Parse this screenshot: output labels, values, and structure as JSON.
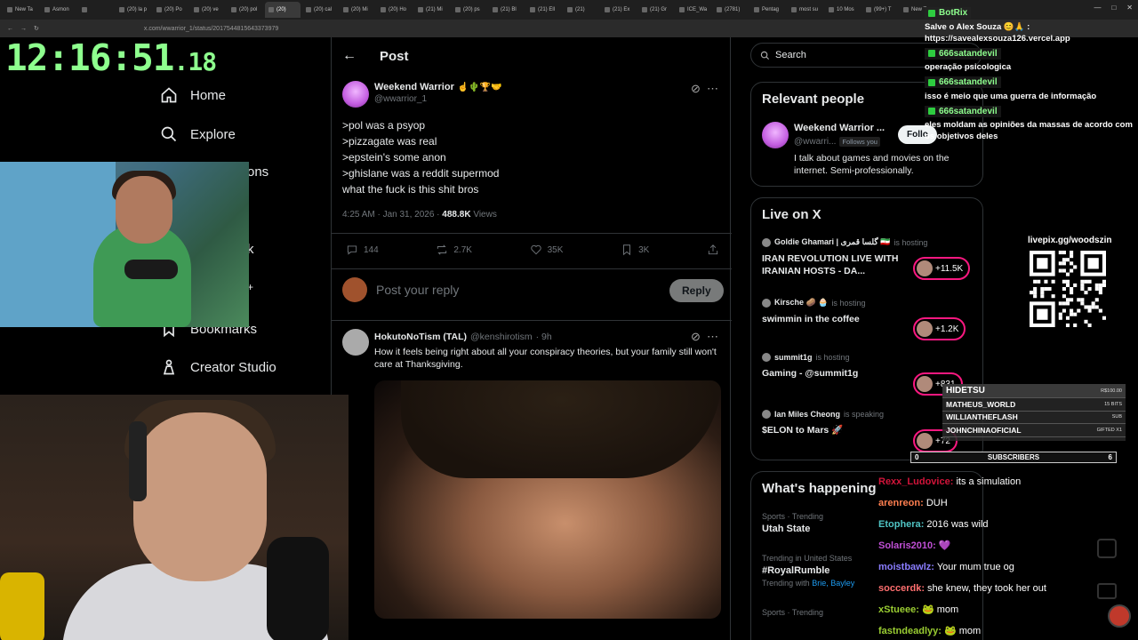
{
  "browser": {
    "tabs": [
      {
        "label": "New Ta",
        "active": false
      },
      {
        "label": "Asmon",
        "active": false
      },
      {
        "label": "",
        "active": false
      },
      {
        "label": "(20) la p",
        "active": false
      },
      {
        "label": "(20) Po",
        "active": false
      },
      {
        "label": "(20) ve",
        "active": false
      },
      {
        "label": "(20) pol",
        "active": false
      },
      {
        "label": "(20)",
        "active": true
      },
      {
        "label": "(20) cal",
        "active": false
      },
      {
        "label": "(20) Mi",
        "active": false
      },
      {
        "label": "(20) Ho",
        "active": false
      },
      {
        "label": "(21) Mi",
        "active": false
      },
      {
        "label": "(20) ps",
        "active": false
      },
      {
        "label": "(21) Bl",
        "active": false
      },
      {
        "label": "(21) Ell",
        "active": false
      },
      {
        "label": "(21)",
        "active": false
      },
      {
        "label": "(21) Ex",
        "active": false
      },
      {
        "label": "(21) Gr",
        "active": false
      },
      {
        "label": "ICE_Wa",
        "active": false
      },
      {
        "label": "(2781)",
        "active": false
      },
      {
        "label": "Pentag",
        "active": false
      },
      {
        "label": "most su",
        "active": false
      },
      {
        "label": "10 Mos",
        "active": false
      },
      {
        "label": "(99+) T",
        "active": false
      },
      {
        "label": "New Ta",
        "active": false
      }
    ],
    "url": "x.com/wwarrior_1/status/2017544815643373979"
  },
  "timer": {
    "main": "12:16:51",
    "fraction": ".18"
  },
  "nav": {
    "home": "Home",
    "explore": "Explore",
    "notifications_partial": "ons",
    "partial_k": "k",
    "partial_plus": "+",
    "bookmarks": "Bookmarks",
    "creator_studio": "Creator Studio"
  },
  "post_header": {
    "title": "Post"
  },
  "tweet": {
    "display_name": "Weekend Warrior",
    "emoji": "☝️🌵🏆🤝",
    "handle": "@wwarrior_1",
    "lines": [
      ">pol was a psyop",
      ">pizzagate was real",
      ">epstein's some anon",
      ">ghislane was a reddit supermod",
      "what the fuck is this shit bros"
    ],
    "time": "4:25 AM · Jan 31, 2026 · ",
    "views_count": "488.8K",
    "views_label": " Views",
    "replies": "144",
    "reposts": "2.7K",
    "likes": "35K",
    "bookmarks": "3K"
  },
  "reply_box": {
    "placeholder": "Post your reply",
    "button": "Reply"
  },
  "reply_tweet": {
    "display_name": "HokutoNoTism (TAL)",
    "handle": "@kenshirotism",
    "time": "· 9h",
    "text": "How it feels being right about all your conspiracy theories, but your family still won't care at Thanksgiving."
  },
  "search": {
    "placeholder": "Search"
  },
  "relevant_people": {
    "title": "Relevant people",
    "name": "Weekend Warrior ...",
    "handle": "@wwarri...",
    "follows_you": "Follows you",
    "follow_label": "Follo",
    "bio": "I talk about games and movies on the internet. Semi-professionally."
  },
  "live_on_x": {
    "title": "Live on X",
    "items": [
      {
        "host": "Goldie Ghamari | گلسا قمری 🇮🇷",
        "status": "is hosting",
        "title": "IRAN REVOLUTION LIVE WITH IRANIAN HOSTS - DA...",
        "count": "+11.5K"
      },
      {
        "host": "Kirsche 🥔 🧁",
        "status": "is hosting",
        "title": "swimmin in the coffee",
        "count": "+1.2K"
      },
      {
        "host": "summit1g",
        "status": "is hosting",
        "title": "Gaming - @summit1g",
        "count": "+831"
      },
      {
        "host": "Ian Miles Cheong",
        "status": "is speaking",
        "title": "$ELON to Mars 🚀",
        "count": "+72"
      }
    ]
  },
  "whats_happening": {
    "title": "What's happening",
    "items": [
      {
        "meta": "Sports · Trending",
        "topic": "Utah State"
      },
      {
        "meta": "Trending in United States",
        "topic": "#RoyalRumble",
        "extra": "Trending with ",
        "links": "Brie, Bayley"
      },
      {
        "meta": "Sports · Trending",
        "topic": ""
      }
    ]
  },
  "overlay_botrix": {
    "name": "BotRix",
    "msg1": "Salve o Alex Souza 😊🙏 :",
    "msg2": "https://savealexsouza126.vercel.app",
    "chat": [
      {
        "user": "666satandevil",
        "text": "operação psicologica"
      },
      {
        "user": "666satandevil",
        "text": "isso é meio que uma guerra de informação"
      },
      {
        "user": "666satandevil",
        "text": "eles moldam as opiniões da massas de acordo com os objetivos deles"
      }
    ]
  },
  "qr": {
    "title": "livepix.gg/woodszin"
  },
  "donations": {
    "rows": [
      {
        "name": "HIDETSU",
        "amount": "R$100.00"
      },
      {
        "name": "MATHEUS_WORLD",
        "amount": "15 BITS"
      },
      {
        "name": "WILLIANTHEFLASH",
        "amount": "SUB"
      },
      {
        "name": "JOHNCHINAOFICIAL",
        "amount": "GIFTED X1"
      }
    ]
  },
  "subbar": {
    "left": "0",
    "label": "SUBSCRIBERS",
    "right": "6"
  },
  "twitch_chat": [
    {
      "user": "Rexx_Ludovice",
      "color": "#d2143a",
      "text": "its a simulation"
    },
    {
      "user": "arenreon",
      "color": "#ff7f50",
      "text": "DUH"
    },
    {
      "user": "Etophera",
      "color": "#4fc3c3",
      "text": "2016 was wild"
    },
    {
      "user": "Solaris2010",
      "color": "#c04fd6",
      "text": "💜"
    },
    {
      "user": "moistbawlz",
      "color": "#8a7dff",
      "text": "Your mum true og"
    },
    {
      "user": "soccerdk",
      "color": "#ff6f6f",
      "text": "she knew, they took her out"
    },
    {
      "user": "xStueee",
      "color": "#9acd32",
      "text": "🐸 mom"
    },
    {
      "user": "fastndeadlyy",
      "color": "#9acd32",
      "text": "🐸 mom"
    }
  ],
  "colors": {
    "accent": "#1d9bf0",
    "live_pink": "#f91880",
    "timer_green": "#8eff8e"
  }
}
